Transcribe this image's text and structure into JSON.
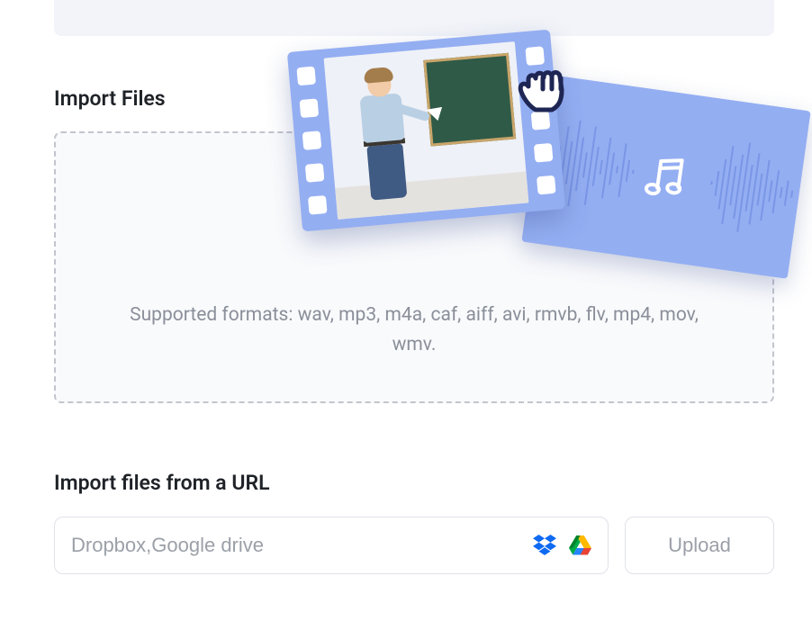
{
  "sections": {
    "import_files": {
      "title": "Import Files",
      "supported_text": "Supported formats: wav, mp3, m4a, caf, aiff, avi, rmvb, flv, mp4, mov, wmv."
    },
    "import_url": {
      "title": "Import files from a URL",
      "input_placeholder": "Dropbox,Google drive",
      "upload_label": "Upload"
    }
  },
  "icons": {
    "dropbox": "dropbox-icon",
    "google_drive": "google-drive-icon",
    "grab_cursor": "grab-cursor-icon",
    "music_note": "music-note-icon"
  }
}
